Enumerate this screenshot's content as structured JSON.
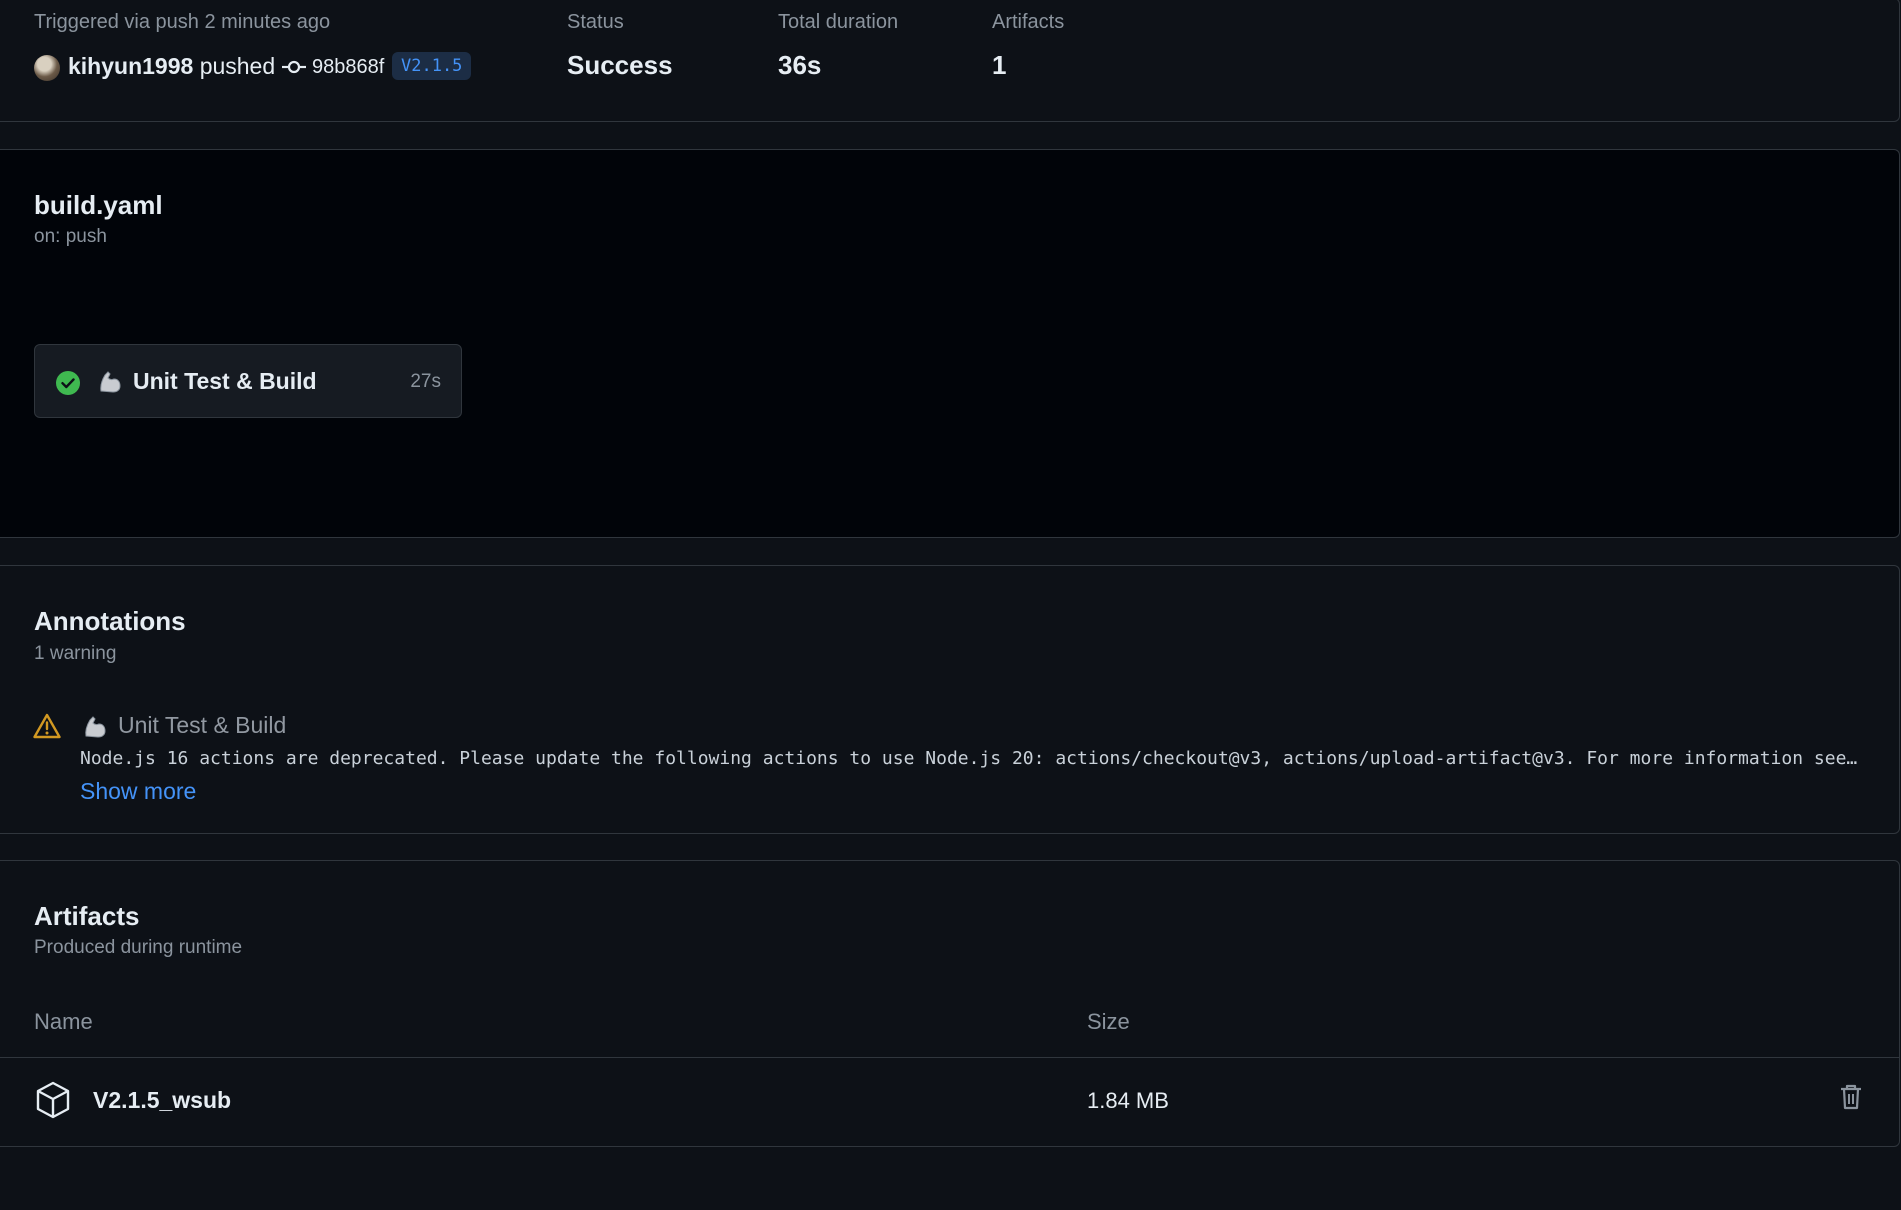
{
  "summary": {
    "trigger_text": "Triggered via push 2 minutes ago",
    "actor": "kihyun1998",
    "action": "pushed",
    "commit_sha": "98b868f",
    "tag": "V2.1.5",
    "status_label": "Status",
    "status_value": "Success",
    "duration_label": "Total duration",
    "duration_value": "36s",
    "artifacts_label": "Artifacts",
    "artifacts_value": "1"
  },
  "workflow": {
    "file": "build.yaml",
    "trigger": "on: push",
    "job": {
      "name": "Unit Test & Build",
      "duration": "27s",
      "status": "success"
    }
  },
  "annotations": {
    "title": "Annotations",
    "count_text": "1 warning",
    "items": [
      {
        "level": "warning",
        "job": "Unit Test & Build",
        "message": "Node.js 16 actions are deprecated. Please update the following actions to use Node.js 20: actions/checkout@v3, actions/upload-artifact@v3. For more information see…",
        "show_more": "Show more"
      }
    ]
  },
  "artifacts": {
    "title": "Artifacts",
    "subtitle": "Produced during runtime",
    "col_name": "Name",
    "col_size": "Size",
    "rows": [
      {
        "name": "V2.1.5_wsub",
        "size": "1.84 MB"
      }
    ]
  },
  "colors": {
    "success": "#3fb950",
    "warning": "#d29922",
    "link": "#4493f8",
    "background": "#0d1117"
  }
}
